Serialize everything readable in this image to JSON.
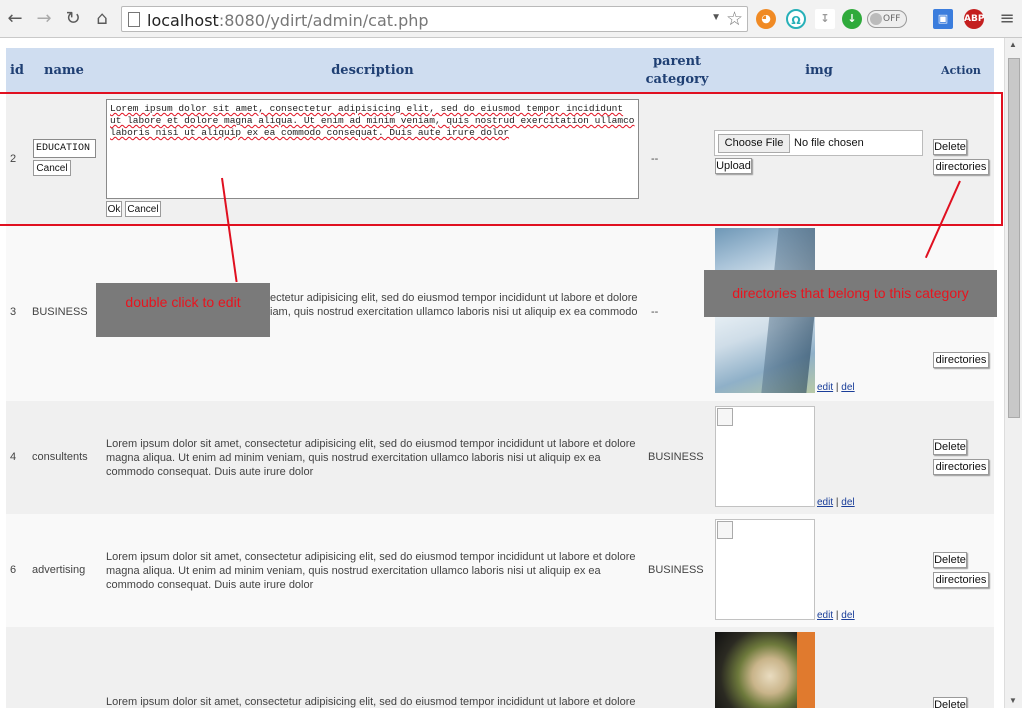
{
  "browser": {
    "url_host": "localhost",
    "url_rest": ":8080/ydirt/admin/cat.php",
    "toggle_label": "OFF",
    "abp_label": "ABP"
  },
  "table": {
    "headers": {
      "id": "id",
      "name": "name",
      "description": "description",
      "parent_line1": "parent",
      "parent_line2": "category",
      "img": "img",
      "action": "Action"
    },
    "editing_row": {
      "id": "2",
      "name_value": "EDUCATION",
      "cancel": "Cancel",
      "description_value": "Lorem ipsum dolor sit amet, consectetur adipisicing elit, sed do eiusmod tempor incididunt ut labore et dolore magna aliqua. Ut enim ad minim veniam, quis nostrud exercitation ullamco laboris nisi ut aliquip ex ea commodo consequat. Duis aute irure dolor",
      "ok": "Ok",
      "desc_cancel": "Cancel",
      "parent": "--",
      "choose_file": "Choose File",
      "no_file": "No file chosen",
      "upload": "Upload",
      "delete": "Delete",
      "directories": "directories"
    },
    "rows": [
      {
        "id": "3",
        "name": "BUSINESS",
        "description_line1": "ectetur adipisicing elit, sed do eiusmod tempor incididunt ut labore et dolore",
        "description_line2": "iam, quis nostrud exercitation ullamco laboris nisi ut aliquip ex ea commodo",
        "parent": "--",
        "edit": "edit",
        "del": "del",
        "directories": "directories"
      },
      {
        "id": "4",
        "name": "consultents",
        "description": "Lorem ipsum dolor sit amet, consectetur adipisicing elit, sed do eiusmod tempor incididunt ut labore et dolore magna aliqua. Ut enim ad minim veniam, quis nostrud exercitation ullamco laboris nisi ut aliquip ex ea commodo consequat. Duis aute irure dolor",
        "parent": "BUSINESS",
        "edit": "edit",
        "del": "del",
        "delete": "Delete",
        "directories": "directories"
      },
      {
        "id": "6",
        "name": "advertising",
        "description": "Lorem ipsum dolor sit amet, consectetur adipisicing elit, sed do eiusmod tempor incididunt ut labore et dolore magna aliqua. Ut enim ad minim veniam, quis nostrud exercitation ullamco laboris nisi ut aliquip ex ea commodo consequat. Duis aute irure dolor",
        "parent": "BUSINESS",
        "edit": "edit",
        "del": "del",
        "delete": "Delete",
        "directories": "directories"
      },
      {
        "description": "Lorem ipsum dolor sit amet, consectetur adipisicing elit, sed do eiusmod tempor incididunt ut labore et dolore",
        "delete": "Delete"
      }
    ],
    "separator": "|"
  },
  "annotations": {
    "double_click": "double click to edit",
    "directories_note": "directories that belong to this category"
  },
  "colors": {
    "header_bg": "#cfddf0",
    "header_text": "#1f3f73",
    "annotation_red": "#e01020",
    "callout_bg": "#7a7a7a"
  }
}
